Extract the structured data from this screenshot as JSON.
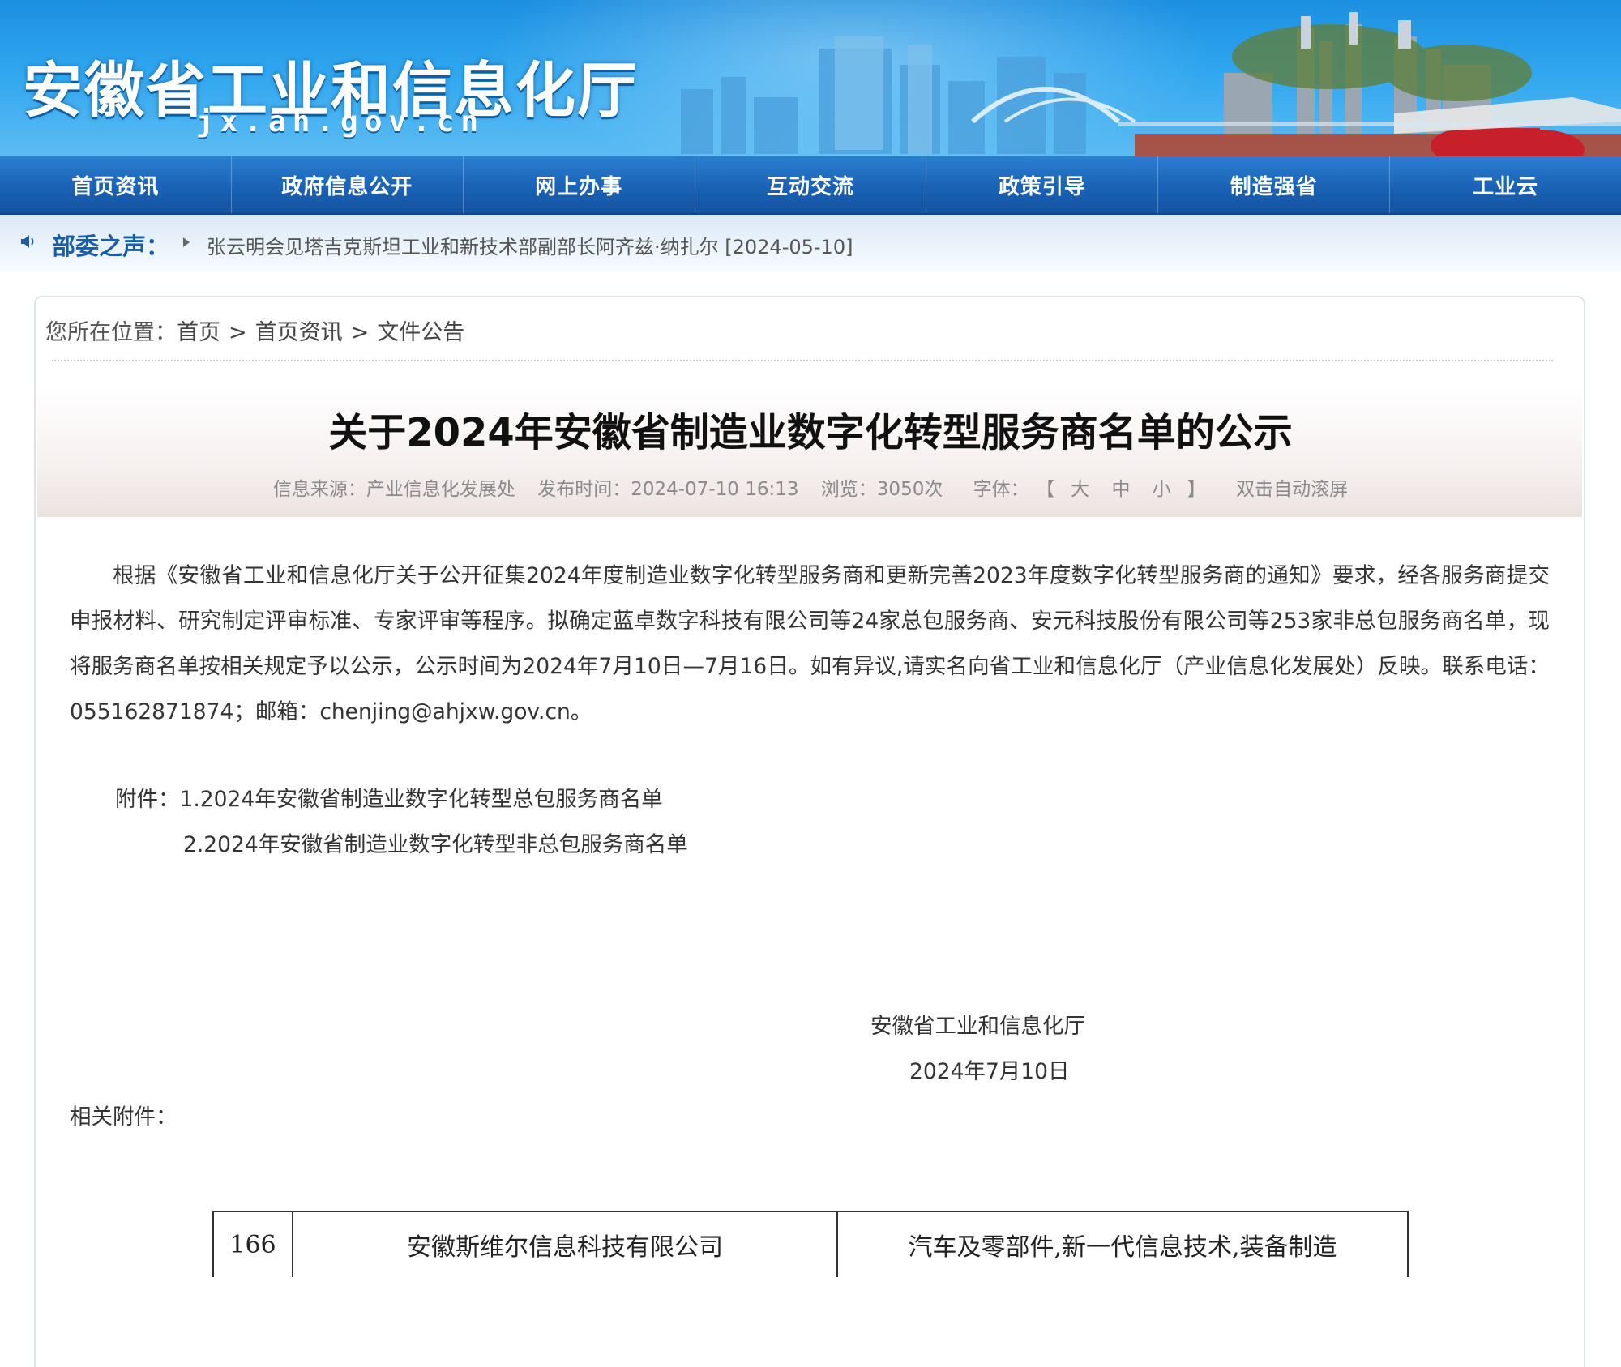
{
  "site": {
    "title": "安徽省工业和信息化厅",
    "domain": "jx.ah.gov.cn"
  },
  "nav": [
    {
      "label": "首页资讯"
    },
    {
      "label": "政府信息公开"
    },
    {
      "label": "网上办事"
    },
    {
      "label": "互动交流"
    },
    {
      "label": "政策引导"
    },
    {
      "label": "制造强省"
    },
    {
      "label": "工业云"
    }
  ],
  "notice": {
    "label": "部委之声：",
    "icon": "speaker-icon",
    "link": "张云明会见塔吉克斯坦工业和新技术部副部长阿齐兹·纳扎尔 [2024-05-10]"
  },
  "breadcrumb": {
    "prefix": "您所在位置：",
    "items": [
      "首页",
      "首页资讯",
      "文件公告"
    ],
    "separator": ">"
  },
  "article": {
    "title": "关于2024年安徽省制造业数字化转型服务商名单的公示",
    "meta": {
      "source": "信息来源：产业信息化发展处",
      "published": "发布时间：2024-07-10 16:13",
      "views": "浏览：3050次",
      "font_label": "字体：",
      "font_open": "【",
      "font_large": "大",
      "font_medium": "中",
      "font_small": "小",
      "font_close": "】",
      "autoscroll": "双击自动滚屏"
    },
    "paragraph": "根据《安徽省工业和信息化厅关于公开征集2024年度制造业数字化转型服务商和更新完善2023年度数字化转型服务商的通知》要求，经各服务商提交申报材料、研究制定评审标准、专家评审等程序。拟确定蓝卓数字科技有限公司等24家总包服务商、安元科技股份有限公司等253家非总包服务商名单，现将服务商名单按相关规定予以公示，公示时间为2024年7月10日—7月16日。如有异议,请实名向省工业和信息化厅（产业信息化发展处）反映。联系电话：055162871874；邮箱：chenjing@ahjxw.gov.cn。",
    "attachments_label": "附件：",
    "attachments": [
      "1.2024年安徽省制造业数字化转型总包服务商名单",
      "2.2024年安徽省制造业数字化转型非总包服务商名单"
    ],
    "signature_org": "安徽省工业和信息化厅",
    "signature_date": "2024年7月10日",
    "related_label": "相关附件："
  },
  "table": {
    "rows": [
      {
        "no": "166",
        "company": "安徽斯维尔信息科技有限公司",
        "field": "汽车及零部件,新一代信息技术,装备制造"
      }
    ]
  },
  "colors": {
    "banner": "#2fa6ef",
    "nav": "#1a62b6",
    "notice_label": "#1a5ea8"
  }
}
